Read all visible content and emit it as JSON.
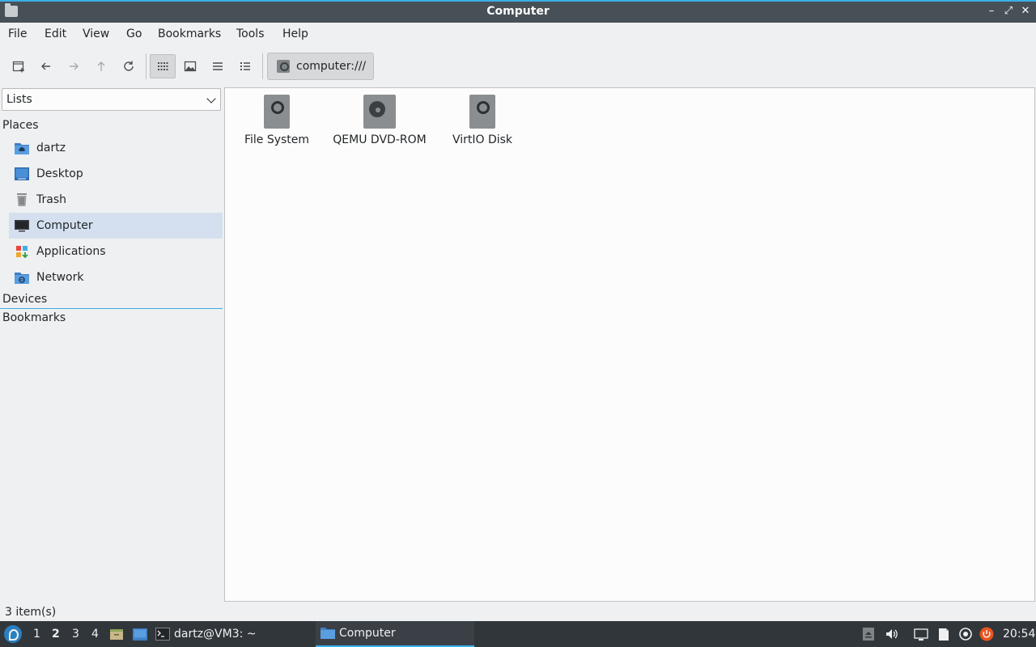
{
  "window": {
    "title": "Computer"
  },
  "menubar": {
    "items": [
      "File",
      "Edit",
      "View",
      "Go",
      "Bookmarks",
      "Tools",
      "Help"
    ]
  },
  "toolbar": {
    "buttons": [
      "new-tab",
      "back",
      "forward",
      "up",
      "reload",
      "icon-view",
      "thumbnail-view",
      "compact-view",
      "detailed-list-view"
    ],
    "active_view": "icon-view",
    "path": "computer:///"
  },
  "sidepane": {
    "mode": "Lists",
    "sections": {
      "places": "Places",
      "devices": "Devices",
      "bookmarks": "Bookmarks"
    },
    "places": [
      {
        "label": "dartz",
        "icon": "home-folder-icon"
      },
      {
        "label": "Desktop",
        "icon": "desktop-icon"
      },
      {
        "label": "Trash",
        "icon": "trash-icon"
      },
      {
        "label": "Computer",
        "icon": "computer-icon",
        "selected": true
      },
      {
        "label": "Applications",
        "icon": "applications-icon"
      },
      {
        "label": "Network",
        "icon": "network-folder-icon"
      }
    ]
  },
  "main": {
    "items": [
      {
        "label": "File System",
        "icon": "drive-harddisk-icon"
      },
      {
        "label": "QEMU DVD-ROM",
        "icon": "drive-optical-icon"
      },
      {
        "label": "VirtIO Disk",
        "icon": "drive-harddisk-icon"
      }
    ]
  },
  "statusbar": {
    "text": "3 item(s)"
  },
  "taskbar": {
    "workspaces": [
      "1",
      "2",
      "3",
      "4"
    ],
    "current_workspace": "2",
    "tasks": [
      {
        "label": "dartz@VM3: ~",
        "icon": "terminal-icon"
      },
      {
        "label": "Computer",
        "icon": "folder-icon",
        "active": true
      }
    ],
    "clock": "20:54"
  },
  "colors": {
    "accent": "#3daee9",
    "titlebar": "#475057",
    "taskbar": "#31363b",
    "selection": "#d4e0ef"
  }
}
